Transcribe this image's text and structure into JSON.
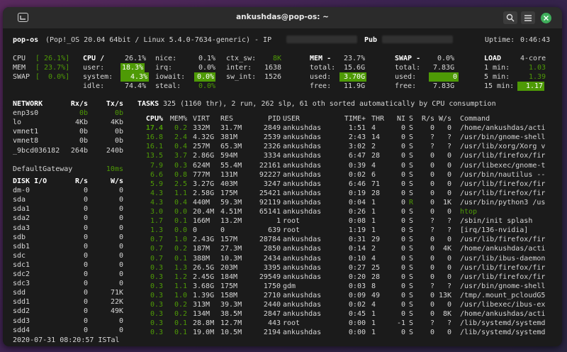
{
  "window": {
    "title": "ankushdas@pop-os: ~"
  },
  "header": {
    "host": "pop-os",
    "os": "(Pop!_OS 20.04 64bit / Linux 5.4.0-7634-generic) - IP",
    "pub": "Pub",
    "uptime_label": "Uptime:",
    "uptime": "0:46:43"
  },
  "quick": {
    "cpu": {
      "label": "CPU",
      "value": "[ 26.1%]"
    },
    "mem": {
      "label": "MEM",
      "value": "[ 23.7%]"
    },
    "swap": {
      "label": "SWAP",
      "value": "[  0.0%]"
    }
  },
  "cpu": {
    "title": "CPU /",
    "total": "26.1%",
    "user_l": "user:",
    "user": "18.3%",
    "system_l": "system:",
    "system": "4.3%",
    "idle_l": "idle:",
    "idle": "74.4%",
    "nice_l": "nice:",
    "nice": "0.1%",
    "irq_l": "irq:",
    "irq": "0.0%",
    "iowait_l": "iowait:",
    "iowait": "0.0%",
    "steal_l": "steal:",
    "steal": "0.0%",
    "ctxsw_l": "ctx_sw:",
    "ctxsw": "8K",
    "inter_l": "inter:",
    "inter": "1638",
    "swint_l": "sw_int:",
    "swint": "1526"
  },
  "mem": {
    "title": "MEM -",
    "pct": "23.7%",
    "total_l": "total:",
    "total": "15.6G",
    "used_l": "used:",
    "used": "3.70G",
    "free_l": "free:",
    "free": "11.9G"
  },
  "swap": {
    "title": "SWAP -",
    "pct": "0.0%",
    "total_l": "total:",
    "total": "7.83G",
    "used_l": "used:",
    "used": "0",
    "free_l": "free:",
    "free": "7.83G"
  },
  "load": {
    "title": "LOAD",
    "cores": "4-core",
    "m1_l": "1 min:",
    "m1": "1.03",
    "m5_l": "5 min:",
    "m5": "1.39",
    "m15_l": "15 min:",
    "m15": "1.17"
  },
  "network": {
    "header": [
      "NETWORK",
      "Rx/s",
      "Tx/s"
    ],
    "rows": [
      [
        "enp3s0",
        "0b",
        "0b"
      ],
      [
        "lo",
        "4Kb",
        "4Kb"
      ],
      [
        "vmnet1",
        "0b",
        "0b"
      ],
      [
        "vmnet8",
        "0b",
        "0b"
      ],
      [
        "_9bcd036182",
        "264b",
        "240b"
      ]
    ],
    "gateway_label": "DefaultGateway",
    "gateway_value": "10ms"
  },
  "disk": {
    "header": [
      "DISK I/O",
      "R/s",
      "W/s"
    ],
    "rows": [
      [
        "dm-0",
        "0",
        "0"
      ],
      [
        "sda",
        "0",
        "0"
      ],
      [
        "sda1",
        "0",
        "0"
      ],
      [
        "sda2",
        "0",
        "0"
      ],
      [
        "sda3",
        "0",
        "0"
      ],
      [
        "sdb",
        "0",
        "0"
      ],
      [
        "sdb1",
        "0",
        "0"
      ],
      [
        "sdc",
        "0",
        "0"
      ],
      [
        "sdc1",
        "0",
        "0"
      ],
      [
        "sdc2",
        "0",
        "0"
      ],
      [
        "sdc3",
        "0",
        "0"
      ],
      [
        "sdd",
        "0",
        "71K"
      ],
      [
        "sdd1",
        "0",
        "22K"
      ],
      [
        "sdd2",
        "0",
        "49K"
      ],
      [
        "sdd3",
        "0",
        "0"
      ],
      [
        "sdd4",
        "0",
        "0"
      ]
    ]
  },
  "tasks": {
    "label": "TASKS",
    "summary": "325 (1160 thr), 2 run, 262 slp, 61 oth sorted automatically by CPU consumption"
  },
  "proc": {
    "headers": [
      "CPU%",
      "MEM%",
      "VIRT",
      "RES",
      "PID",
      "USER",
      "TIME+",
      "THR",
      "NI",
      "S",
      "R/s",
      "W/s",
      "Command"
    ],
    "rows": [
      [
        "17.4",
        "0.2",
        "332M",
        "31.7M",
        "2849",
        "ankushdas",
        "1:51",
        "4",
        "0",
        "S",
        "0",
        "0",
        "/home/ankushdas/acti"
      ],
      [
        "16.8",
        "2.4",
        "4.32G",
        "381M",
        "2539",
        "ankushdas",
        "2:43",
        "14",
        "0",
        "S",
        "?",
        "?",
        "/usr/bin/gnome-shell"
      ],
      [
        "16.1",
        "0.4",
        "257M",
        "65.3M",
        "2326",
        "ankushdas",
        "3:02",
        "2",
        "0",
        "S",
        "?",
        "?",
        "/usr/lib/xorg/Xorg v"
      ],
      [
        "13.5",
        "3.7",
        "2.86G",
        "594M",
        "3334",
        "ankushdas",
        "6:47",
        "28",
        "0",
        "S",
        "0",
        "0",
        "/usr/lib/firefox/fir"
      ],
      [
        "7.9",
        "0.3",
        "624M",
        "55.4M",
        "22161",
        "ankushdas",
        "0:39",
        "4",
        "0",
        "S",
        "0",
        "0",
        "/usr/libexec/gnome-t"
      ],
      [
        "6.6",
        "0.8",
        "777M",
        "131M",
        "92227",
        "ankushdas",
        "0:02",
        "6",
        "0",
        "S",
        "0",
        "0",
        "/usr/bin/nautilus --"
      ],
      [
        "5.9",
        "2.5",
        "3.27G",
        "403M",
        "3247",
        "ankushdas",
        "6:46",
        "71",
        "0",
        "S",
        "0",
        "0",
        "/usr/lib/firefox/fir"
      ],
      [
        "4.3",
        "1.1",
        "2.58G",
        "175M",
        "25421",
        "ankushdas",
        "0:19",
        "28",
        "0",
        "S",
        "0",
        "0",
        "/usr/lib/firefox/fir"
      ],
      [
        "4.3",
        "0.4",
        "440M",
        "59.3M",
        "92119",
        "ankushdas",
        "0:04",
        "1",
        "0",
        "R",
        "0",
        "1K",
        "/usr/bin/python3 /us"
      ],
      [
        "3.0",
        "0.0",
        "20.4M",
        "4.51M",
        "65141",
        "ankushdas",
        "0:26",
        "1",
        "0",
        "S",
        "0",
        "0",
        "htop"
      ],
      [
        "1.7",
        "0.1",
        "166M",
        "13.2M",
        "1",
        "root",
        "0:08",
        "1",
        "0",
        "S",
        "?",
        "?",
        "/sbin/init splash"
      ],
      [
        "1.3",
        "0.0",
        "0",
        "0",
        "639",
        "root",
        "1:19",
        "1",
        "0",
        "S",
        "?",
        "?",
        "[irq/136-nvidia]"
      ],
      [
        "0.7",
        "1.0",
        "2.43G",
        "157M",
        "28784",
        "ankushdas",
        "0:31",
        "29",
        "0",
        "S",
        "0",
        "0",
        "/usr/lib/firefox/fir"
      ],
      [
        "0.7",
        "0.2",
        "187M",
        "27.3M",
        "2850",
        "ankushdas",
        "0:14",
        "2",
        "0",
        "S",
        "0",
        "4K",
        "/home/ankushdas/acti"
      ],
      [
        "0.7",
        "0.1",
        "388M",
        "10.3M",
        "2434",
        "ankushdas",
        "0:10",
        "4",
        "0",
        "S",
        "0",
        "0",
        "/usr/lib/ibus-daemon"
      ],
      [
        "0.3",
        "1.3",
        "26.5G",
        "203M",
        "3395",
        "ankushdas",
        "0:27",
        "25",
        "0",
        "S",
        "0",
        "0",
        "/usr/lib/firefox/fir"
      ],
      [
        "0.3",
        "1.2",
        "2.45G",
        "184M",
        "29549",
        "ankushdas",
        "0:20",
        "28",
        "0",
        "S",
        "0",
        "0",
        "/usr/lib/firefox/fir"
      ],
      [
        "0.3",
        "1.1",
        "3.68G",
        "175M",
        "1750",
        "gdm",
        "0:03",
        "8",
        "0",
        "S",
        "?",
        "?",
        "/usr/bin/gnome-shell"
      ],
      [
        "0.3",
        "1.0",
        "1.39G",
        "158M",
        "2710",
        "ankushdas",
        "0:09",
        "49",
        "0",
        "S",
        "0",
        "13K",
        "/tmp/.mount_pcloudG5"
      ],
      [
        "0.3",
        "0.2",
        "313M",
        "39.3M",
        "2440",
        "ankushdas",
        "0:02",
        "4",
        "0",
        "S",
        "0",
        "0",
        "/usr/libexec/ibus-ex"
      ],
      [
        "0.3",
        "0.2",
        "134M",
        "38.5M",
        "2847",
        "ankushdas",
        "0:45",
        "1",
        "0",
        "S",
        "0",
        "8K",
        "/home/ankushdas/acti"
      ],
      [
        "0.3",
        "0.1",
        "28.8M",
        "12.7M",
        "443",
        "root",
        "0:00",
        "1",
        "-1",
        "S",
        "?",
        "?",
        "/lib/systemd/systemd"
      ],
      [
        "0.3",
        "0.1",
        "19.0M",
        "10.5M",
        "2194",
        "ankushdas",
        "0:00",
        "1",
        "0",
        "S",
        "0",
        "0",
        "/lib/systemd/systemd"
      ]
    ]
  },
  "footer": {
    "datetime": "2020-07-31 08:20:57 ISTal"
  }
}
